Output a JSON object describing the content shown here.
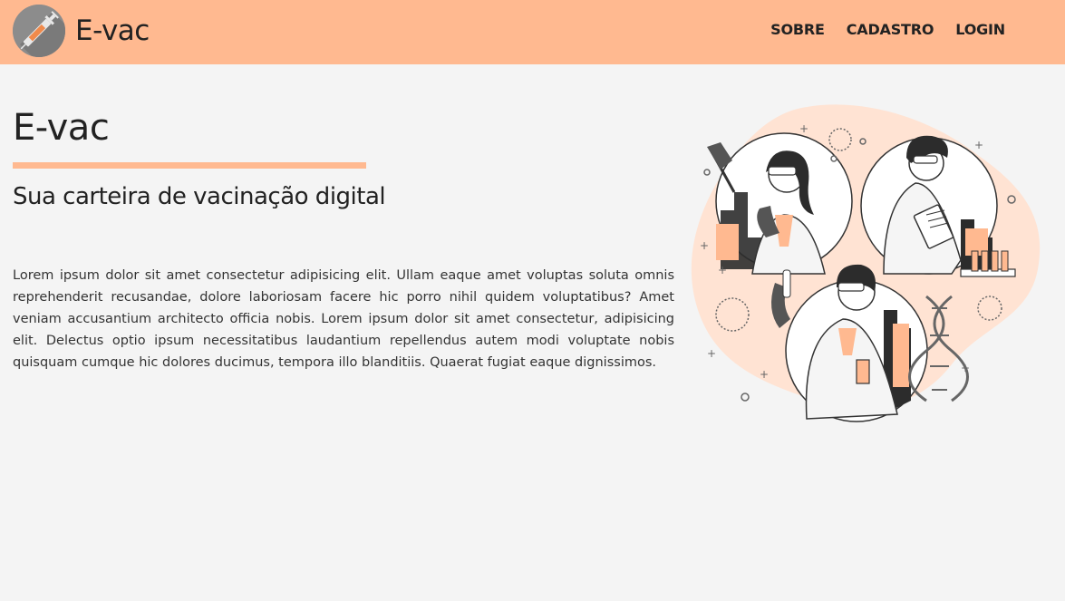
{
  "navbar": {
    "brand_name": "E-vac",
    "logo_icon": "syringe-icon",
    "links": [
      {
        "label": "SOBRE"
      },
      {
        "label": "CADASTRO"
      },
      {
        "label": "LOGIN"
      }
    ],
    "background_color": "#ffb990"
  },
  "hero": {
    "title": "E-vac",
    "subtitle": "Sua carteira de vacinação digital",
    "text": "Lorem ipsum dolor sit amet consectetur adipisicing elit. Ullam eaque amet voluptas soluta omnis reprehenderit recusandae, dolore laboriosam facere hic porro nihil quidem voluptatibus? Amet veniam accusantium architecto officia nobis. Lorem ipsum dolor sit amet consectetur, adipisicing elit. Delectus optio ipsum necessitatibus laudantium repellendus autem modi voluptate nobis quisquam cumque hic dolores ducimus, tempora illo blanditiis. Quaerat fugiat eaque dignissimos.",
    "accent_color": "#ffb990",
    "illustration": "scientists-illustration"
  }
}
